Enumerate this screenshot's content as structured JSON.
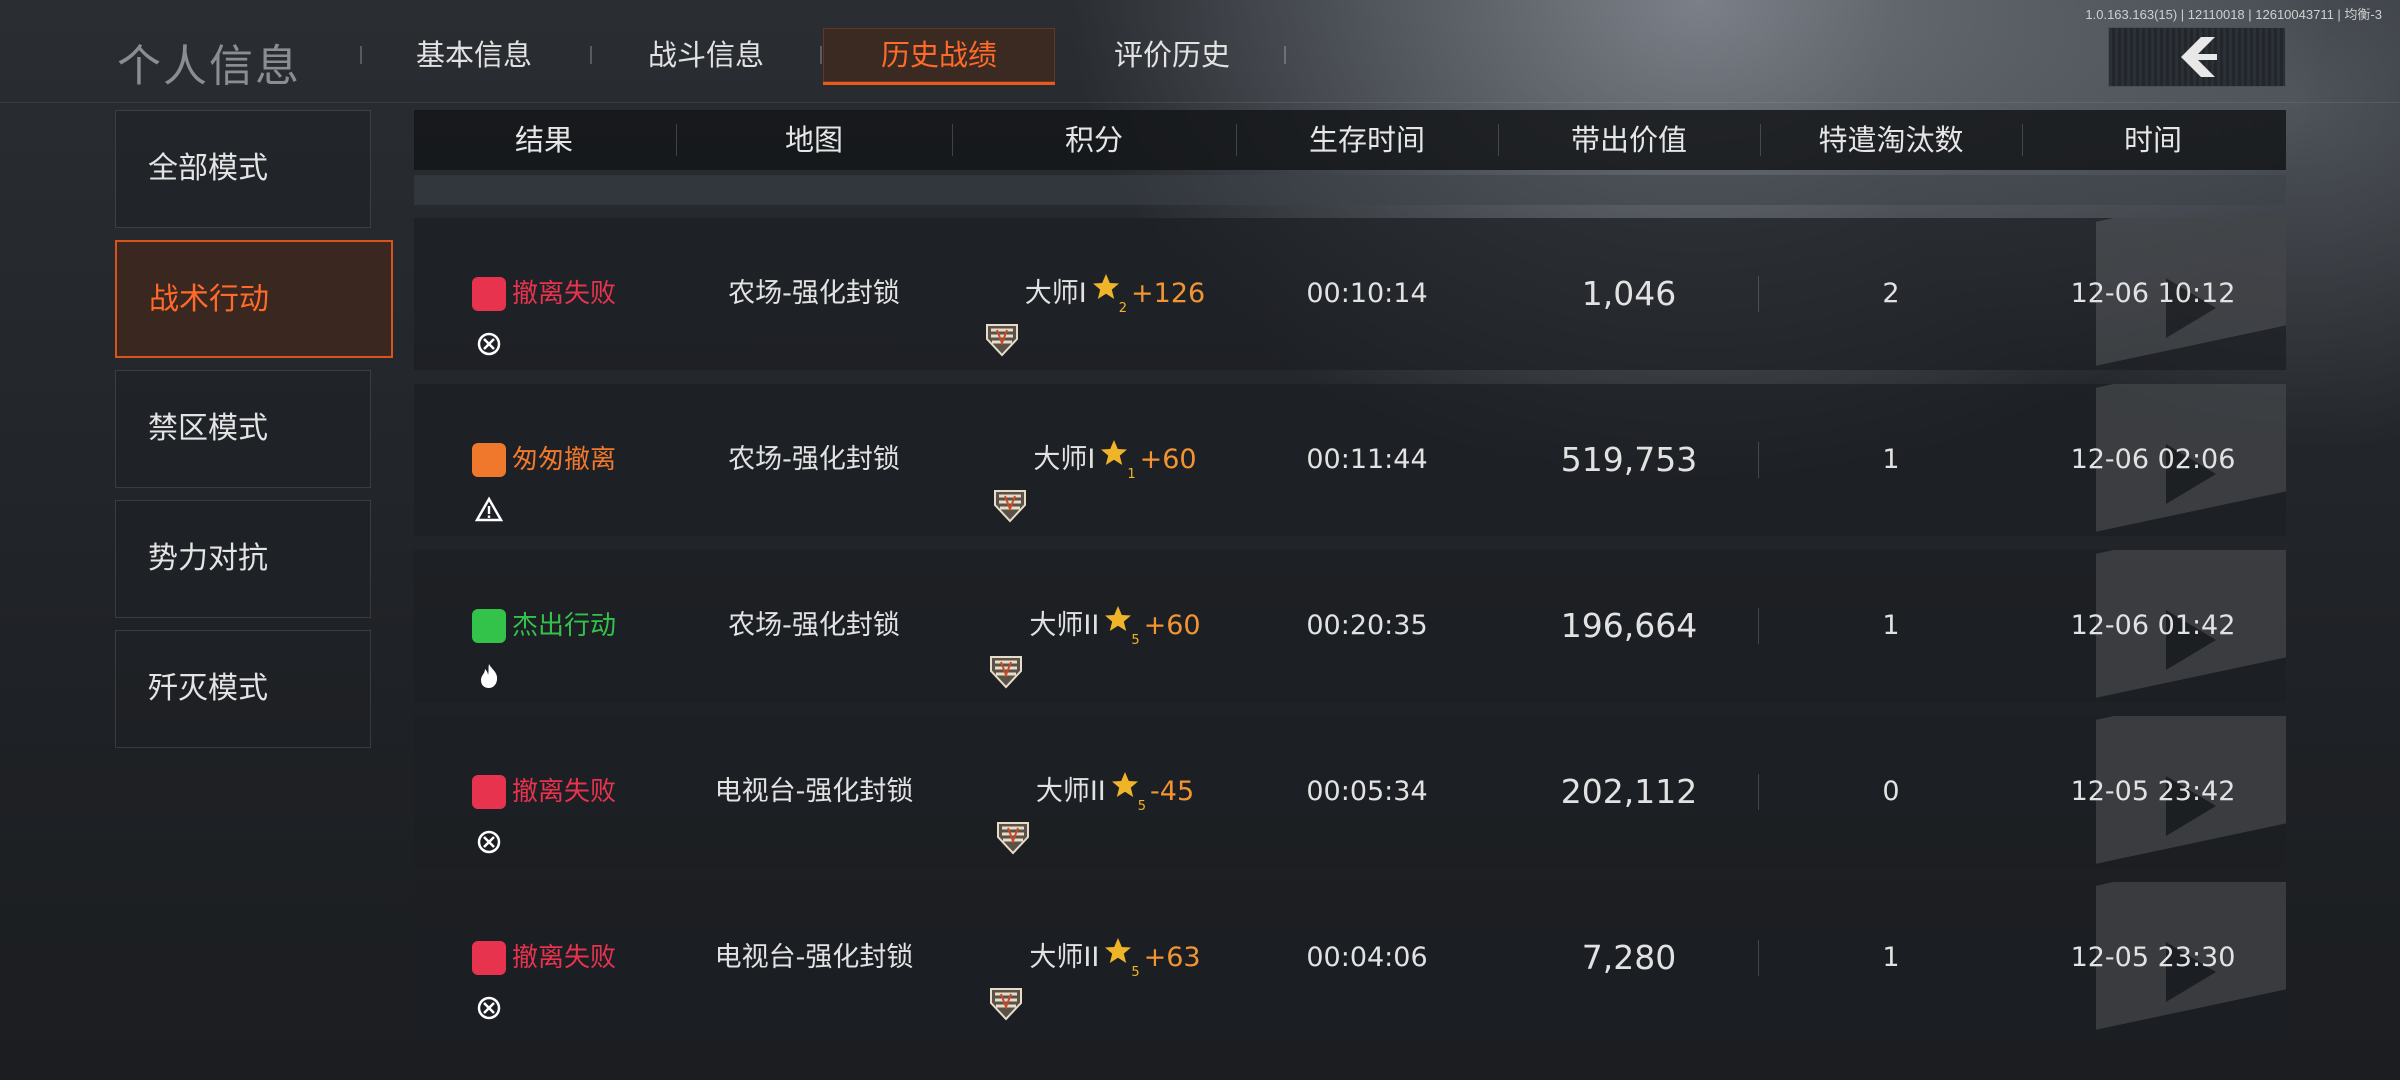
{
  "version": "1.0.163.163(15) | 12110018 | 12610043711 | 均衡-3",
  "header": {
    "title": "个人信息",
    "tabs": [
      {
        "label": "基本信息",
        "active": false
      },
      {
        "label": "战斗信息",
        "active": false
      },
      {
        "label": "历史战绩",
        "active": true
      },
      {
        "label": "评价历史",
        "active": false
      }
    ],
    "back_icon": "chevron-left-icon"
  },
  "sidebar": {
    "items": [
      {
        "label": "全部模式",
        "active": false
      },
      {
        "label": "战术行动",
        "active": true
      },
      {
        "label": "禁区模式",
        "active": false
      },
      {
        "label": "势力对抗",
        "active": false
      },
      {
        "label": "歼灭模式",
        "active": false
      }
    ]
  },
  "table": {
    "columns": [
      "结果",
      "地图",
      "积分",
      "生存时间",
      "带出价值",
      "特遣淘汰数",
      "时间"
    ],
    "rows": [
      {
        "result": "撤离失败",
        "result_type": "fail",
        "map": "农场-强化封锁",
        "rank": "大师I",
        "rank_roman": "I",
        "stars": "2",
        "delta": "+126",
        "survival": "00:10:14",
        "value": "1,046",
        "kills": "2",
        "time": "12-06 10:12"
      },
      {
        "result": "匆匆撤离",
        "result_type": "hasty",
        "map": "农场-强化封锁",
        "rank": "大师I",
        "rank_roman": "I",
        "stars": "1",
        "delta": "+60",
        "survival": "00:11:44",
        "value": "519,753",
        "kills": "1",
        "time": "12-06 02:06"
      },
      {
        "result": "杰出行动",
        "result_type": "excellent",
        "map": "农场-强化封锁",
        "rank": "大师II",
        "rank_roman": "II",
        "stars": "5",
        "delta": "+60",
        "survival": "00:20:35",
        "value": "196,664",
        "kills": "1",
        "time": "12-06 01:42"
      },
      {
        "result": "撤离失败",
        "result_type": "fail",
        "map": "电视台-强化封锁",
        "rank": "大师II",
        "rank_roman": "II",
        "stars": "5",
        "delta": "-45",
        "survival": "00:05:34",
        "value": "202,112",
        "kills": "0",
        "time": "12-05 23:42"
      },
      {
        "result": "撤离失败",
        "result_type": "fail",
        "map": "电视台-强化封锁",
        "rank": "大师II",
        "rank_roman": "II",
        "stars": "5",
        "delta": "+63",
        "survival": "00:04:06",
        "value": "7,280",
        "kills": "1",
        "time": "12-05 23:30"
      }
    ]
  },
  "colors": {
    "accent": "#ff6a2a",
    "fail": "#e8334f",
    "hasty": "#f0782c",
    "excellent": "#33c24a",
    "score_delta": "#f39433",
    "star": "#f0b429"
  }
}
